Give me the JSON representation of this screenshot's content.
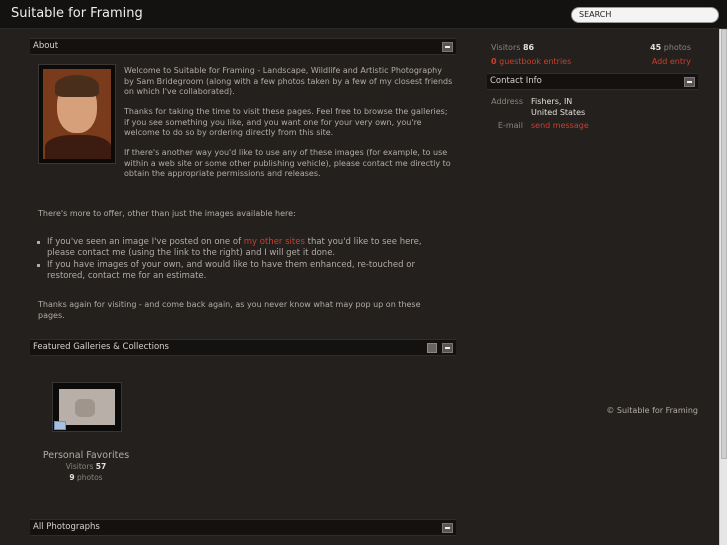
{
  "header": {
    "site_title": "Suitable for Framing",
    "search_placeholder": "SEARCH"
  },
  "about": {
    "heading": "About",
    "intro": "Welcome to Suitable for Framing - Landscape, Wildlife and Artistic Photography by Sam Bridegroom (along with a few photos taken by a few of my closest friends on which I've collaborated).",
    "thanks": "Thanks for taking the time to visit these pages. Feel free to browse the galleries; if you see something you like, and you want one for your very own, you're welcome to do so by ordering directly from this site.",
    "other_use": "If there's another way you'd like to use any of these images (for example, to use within a web site or some other publishing vehicle), please contact me directly to obtain the appropriate permissions and releases.",
    "more": "There's more to offer, other than just the images available here:",
    "bullet1_pre": "If you've seen an image I've posted on one of ",
    "bullet1_link": "my other sites",
    "bullet1_post": " that you'd like to see here, please contact me (using the link to the right) and I will get it done.",
    "bullet2": "If you have images of your own, and would like to have them enhanced, re-touched or restored, contact me for an estimate.",
    "closing": "Thanks again for visiting - and come back again, as you never know what may pop up on these pages."
  },
  "featured": {
    "heading": "Featured Galleries & Collections",
    "gallery": {
      "title": "Personal Favorites",
      "visitors_label": "Visitors",
      "visitors": "57",
      "photos_count": "9",
      "photos_label": "photos"
    }
  },
  "all_photos": {
    "heading": "All Photographs"
  },
  "sidebar": {
    "visitors_label": "Visitors",
    "visitors": "86",
    "photos_count": "45",
    "photos_label": "photos",
    "guestbook_count": "0",
    "guestbook_label": "guestbook entries",
    "add_entry": "Add entry",
    "contact_heading": "Contact Info",
    "address_label": "Address",
    "address_line1": "Fishers, IN",
    "address_line2": "United States",
    "email_label": "E-mail",
    "email_link": "send message",
    "copyright": "© Suitable for Framing"
  },
  "colors": {
    "background": "#23201e",
    "bar": "#141211",
    "link": "#c9402d",
    "text": "#b3aca4"
  }
}
